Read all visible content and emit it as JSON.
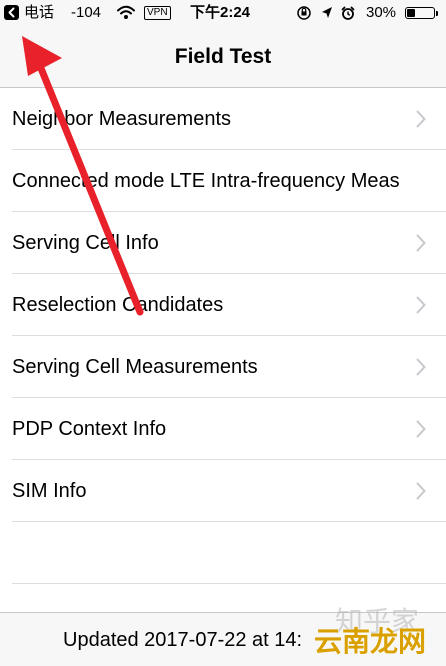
{
  "status_bar": {
    "carrier": "电话",
    "signal": "-104",
    "vpn": "VPN",
    "time": "下午2:24",
    "battery": "30%",
    "battery_level": 0.3,
    "icons": [
      "back-to-app-icon",
      "wifi-icon",
      "lock-rotation-icon",
      "location-icon",
      "alarm-icon",
      "battery-icon"
    ]
  },
  "nav": {
    "title": "Field Test"
  },
  "list": {
    "items": [
      {
        "label": "Neighbor Measurements"
      },
      {
        "label": "Connected mode LTE Intra-frequency Meas"
      },
      {
        "label": "Serving Cell Info"
      },
      {
        "label": "Reselection Candidates"
      },
      {
        "label": "Serving Cell Measurements"
      },
      {
        "label": "PDP Context Info"
      },
      {
        "label": "SIM Info"
      }
    ]
  },
  "footer": {
    "updated": "Updated 2017-07-22 at 14:"
  },
  "watermark": {
    "top": "知乎家",
    "bottom": "云南龙网"
  },
  "colors": {
    "annotation_arrow": "#e8212a",
    "chevron": "#c7c7cc",
    "bar_bg": "#f7f7f7",
    "separator": "#dedee2"
  }
}
